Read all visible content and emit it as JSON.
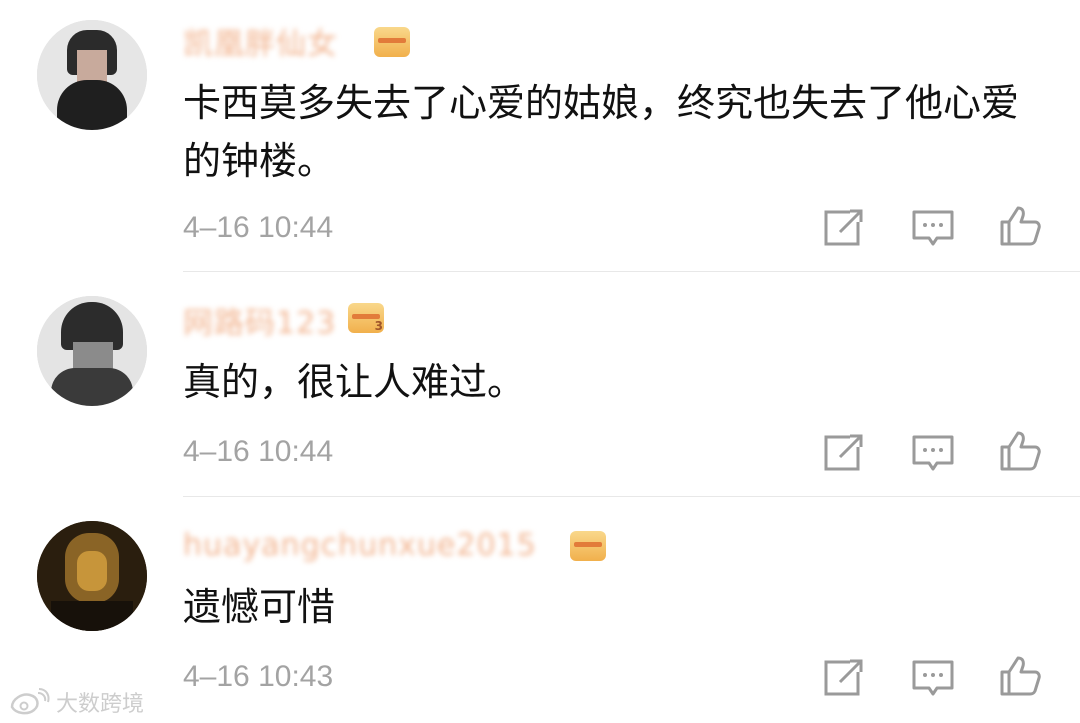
{
  "comments": [
    {
      "username": "凯凰胖仙女",
      "badge_level": "",
      "text": "卡西莫多失去了心爱的姑娘，终究也失去了他心爱的钟楼。",
      "time": "4–16 10:44",
      "avatar_colors": [
        "#d9d9d9",
        "#2a2a2a",
        "#c9a99a",
        "#f0f0f0"
      ]
    },
    {
      "username": "网路码123",
      "badge_level": "3",
      "text": "真的，很让人难过。",
      "time": "4–16 10:44",
      "avatar_colors": [
        "#cfcfcf",
        "#2c2c2c",
        "#8a8a8a",
        "#e8e8e8"
      ]
    },
    {
      "username": "huayangchunxue2015",
      "badge_level": "",
      "text": "遗憾可惜",
      "time": "4–16 10:43",
      "avatar_colors": [
        "#3a2a15",
        "#b9872e",
        "#6d4f22",
        "#1c140a"
      ]
    }
  ],
  "actions": {
    "forward_icon": "share-edit-icon",
    "reply_icon": "comment-bubble-icon",
    "like_icon": "thumbs-up-icon"
  },
  "colors": {
    "username": "#f2b48f",
    "badge": "#f1b04c",
    "time": "#a3a3a3",
    "icon": "#9a9a9a"
  },
  "watermark": {
    "text": "大数跨境"
  }
}
